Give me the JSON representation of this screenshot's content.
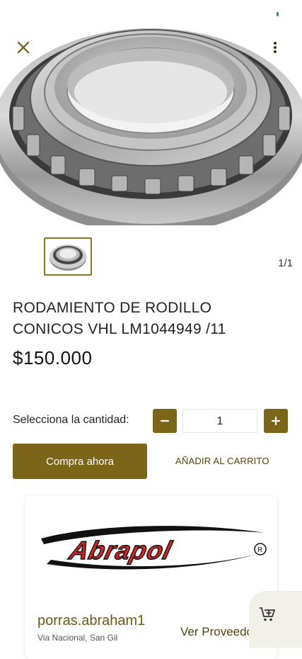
{
  "product": {
    "image_counter": "1/1",
    "title_line1": "RODAMIENTO DE RODILLO",
    "title_line2": "CONICOS VHL LM1044949 /11",
    "price": "$150.000"
  },
  "quantity": {
    "label": "Selecciona la cantidad:",
    "value": "1"
  },
  "actions": {
    "buy_label": "Compra ahora",
    "add_to_cart_label": "AÑADIR AL CARRITO"
  },
  "seller": {
    "logo_text": "Abrapol",
    "name": "porras.abraham1",
    "subtitle": "Via Nacional, San Gil",
    "link_label": "Ver Proveedor"
  },
  "icons": {
    "close": "close-icon",
    "more": "more-vertical-icon",
    "minus": "minus-icon",
    "plus": "plus-icon",
    "cart": "cart-add-icon"
  },
  "colors": {
    "accent": "#7a6518",
    "accent_text": "#4e4310",
    "status": "#2e9e3c"
  }
}
